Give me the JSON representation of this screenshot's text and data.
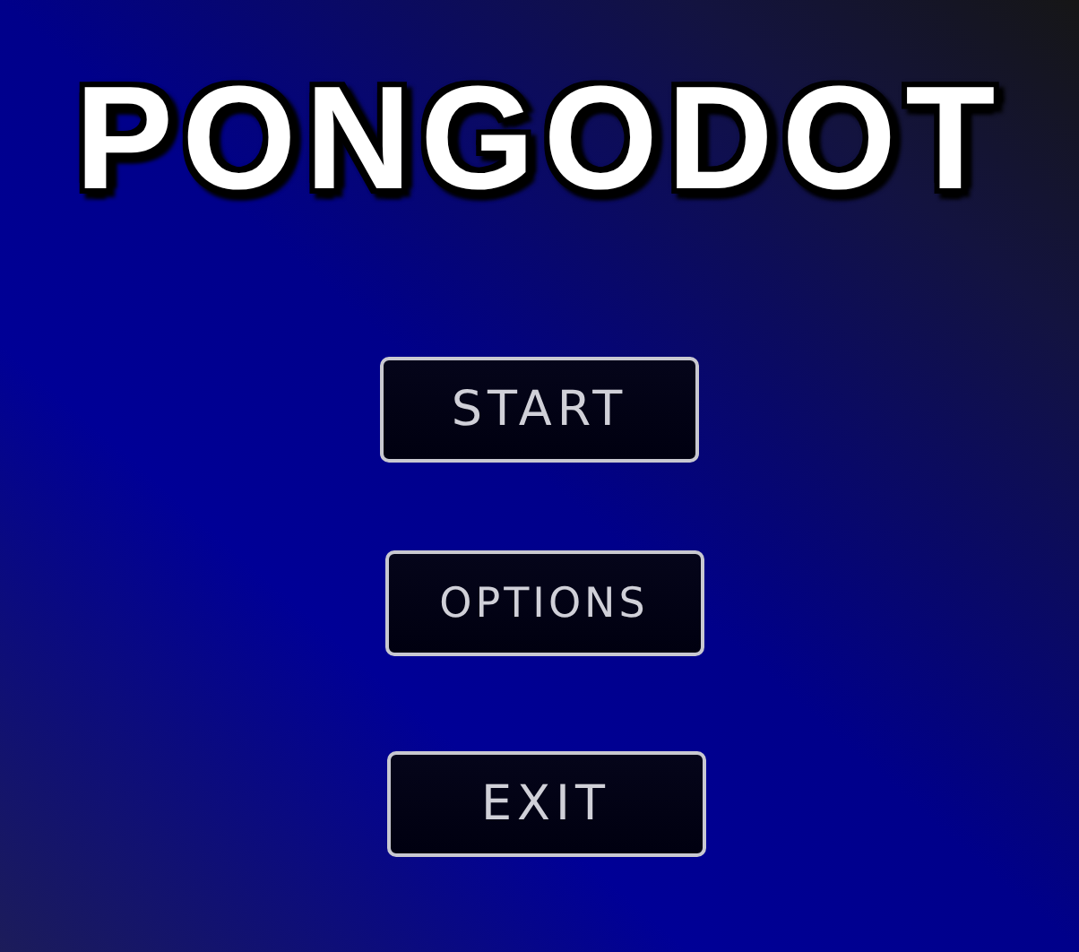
{
  "title": "PONGODOT",
  "buttons": [
    {
      "label": "START"
    },
    {
      "label": "OPTIONS"
    },
    {
      "label": "EXIT"
    }
  ]
}
